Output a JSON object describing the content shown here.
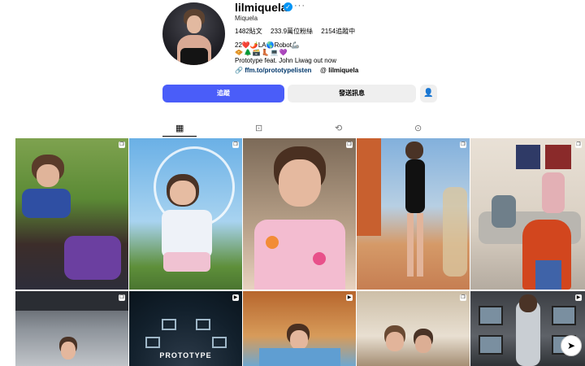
{
  "profile": {
    "username": "lilmiquela",
    "verified_icon": "verified-badge-icon",
    "more_label": "···",
    "full_name": "Miquela",
    "stats": {
      "posts": "1482貼文",
      "followers": "233.9萬位粉絲",
      "following": "2154追蹤中"
    },
    "bio_line1": "22❤️🌶️LA🌎Robot🦾",
    "bio_line2": "🧇🌲🗃️👢💻💜",
    "bio_line3": "Prototype feat. John Liwag out now",
    "link_url": "ffm.to/prototypelisten",
    "threads_handle": "lilmiquela"
  },
  "actions": {
    "follow_label": "追蹤",
    "message_label": "發送訊息",
    "suggest_icon": "add-person-icon"
  },
  "tabs": [
    {
      "icon": "grid-icon",
      "glyph": "▦"
    },
    {
      "icon": "reels-icon",
      "glyph": "⊡"
    },
    {
      "icon": "repost-icon",
      "glyph": "⟲"
    },
    {
      "icon": "tagged-icon",
      "glyph": "⊙"
    }
  ],
  "grid": {
    "captions": {
      "tile_7": "PROTOTYPE"
    }
  },
  "colors": {
    "accent": "#4a5df9",
    "link": "#00376b",
    "verified": "#0095f6"
  }
}
